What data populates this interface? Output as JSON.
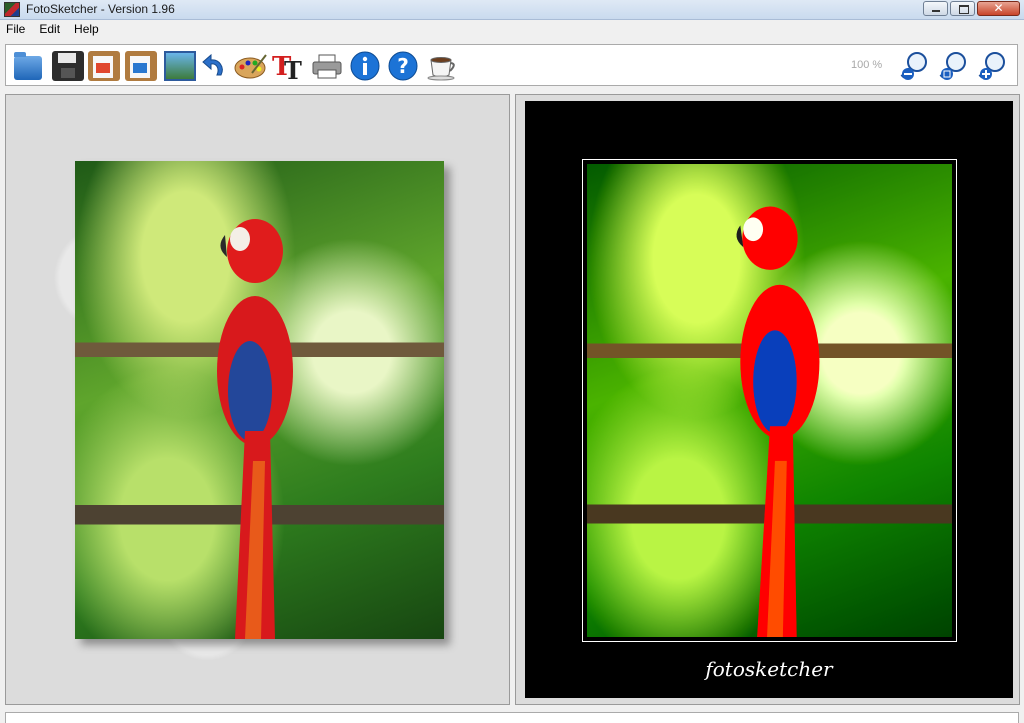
{
  "window": {
    "title": "FotoSketcher - Version 1.96",
    "controls": [
      "minimize",
      "maximize",
      "close"
    ]
  },
  "menubar": {
    "items": [
      {
        "label": "File"
      },
      {
        "label": "Edit"
      },
      {
        "label": "Help"
      }
    ]
  },
  "toolbar": {
    "icons": [
      "open-folder-icon",
      "save-disk-icon",
      "copy-clipboard-icon",
      "paste-clipboard-icon",
      "image-edit-icon",
      "undo-arrow-icon",
      "palette-icon",
      "text-icon",
      "printer-icon",
      "info-icon",
      "help-icon",
      "coffee-cup-icon"
    ],
    "zoom_level": "100 %",
    "zoom_icons": [
      "zoom-out-icon",
      "zoom-reset-icon",
      "zoom-in-icon"
    ]
  },
  "original_panel": {
    "content": "parrot photo"
  },
  "result_panel": {
    "signature": "fotosketcher"
  },
  "colors": {
    "frame": "#000000",
    "panel_bg": "#dcdcdc",
    "parrot_red": "#d8191c",
    "parrot_blue": "#23479a"
  }
}
